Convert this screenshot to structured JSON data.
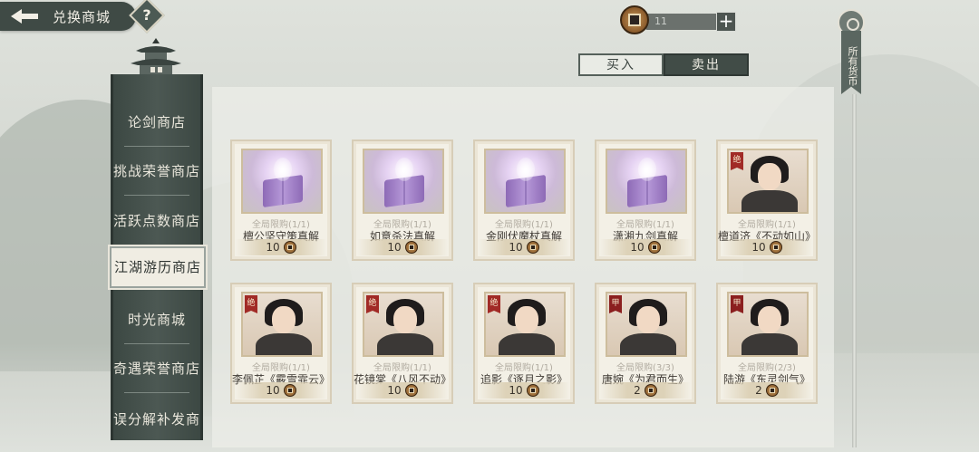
{
  "header": {
    "title": "兑换商城",
    "help_label": "?",
    "back_icon": "back-arrow-icon"
  },
  "currency": {
    "amount": "11",
    "add_label": "+",
    "icon": "coin-icon"
  },
  "tabs": [
    {
      "label": "买入",
      "active": true
    },
    {
      "label": "卖出",
      "active": false
    }
  ],
  "all_currency_label": "所有货币",
  "sidebar": {
    "items": [
      {
        "label": "论剑商店",
        "active": false
      },
      {
        "label": "挑战荣誉商店",
        "active": false
      },
      {
        "label": "活跃点数商店",
        "active": false
      },
      {
        "label": "江湖游历商店",
        "active": true
      },
      {
        "label": "时光商城",
        "active": false
      },
      {
        "label": "奇遇荣誉商店",
        "active": false
      },
      {
        "label": "误分解补发商",
        "active": false
      }
    ]
  },
  "goods": [
    {
      "type": "book",
      "limit": "全局限购(1/1)",
      "name": "檀公坚守策真解",
      "price": "10"
    },
    {
      "type": "book",
      "limit": "全局限购(1/1)",
      "name": "如意杀法真解",
      "price": "10"
    },
    {
      "type": "book",
      "limit": "全局限购(1/1)",
      "name": "金刚伏魔杖真解",
      "price": "10"
    },
    {
      "type": "book",
      "limit": "全局限购(1/1)",
      "name": "潇湘九剑真解",
      "price": "10"
    },
    {
      "type": "hero",
      "badge": "绝",
      "limit": "全局限购(1/1)",
      "name": "檀道济《不动如山》",
      "price": "10"
    },
    {
      "type": "hero",
      "badge": "绝",
      "limit": "全局限购(1/1)",
      "name": "李佩芷《霰雪霏云》",
      "price": "10"
    },
    {
      "type": "hero",
      "badge": "绝",
      "limit": "全局限购(1/1)",
      "name": "花镜棠《八风不动》",
      "price": "10"
    },
    {
      "type": "hero",
      "badge": "绝",
      "limit": "全局限购(1/1)",
      "name": "追影《逐月之影》",
      "price": "10"
    },
    {
      "type": "hero",
      "badge": "甲",
      "limit": "全局限购(3/3)",
      "name": "唐婉《为君而生》",
      "price": "2"
    },
    {
      "type": "hero",
      "badge": "甲",
      "limit": "全局限购(2/3)",
      "name": "陆游《东灵剑气》",
      "price": "2"
    }
  ]
}
